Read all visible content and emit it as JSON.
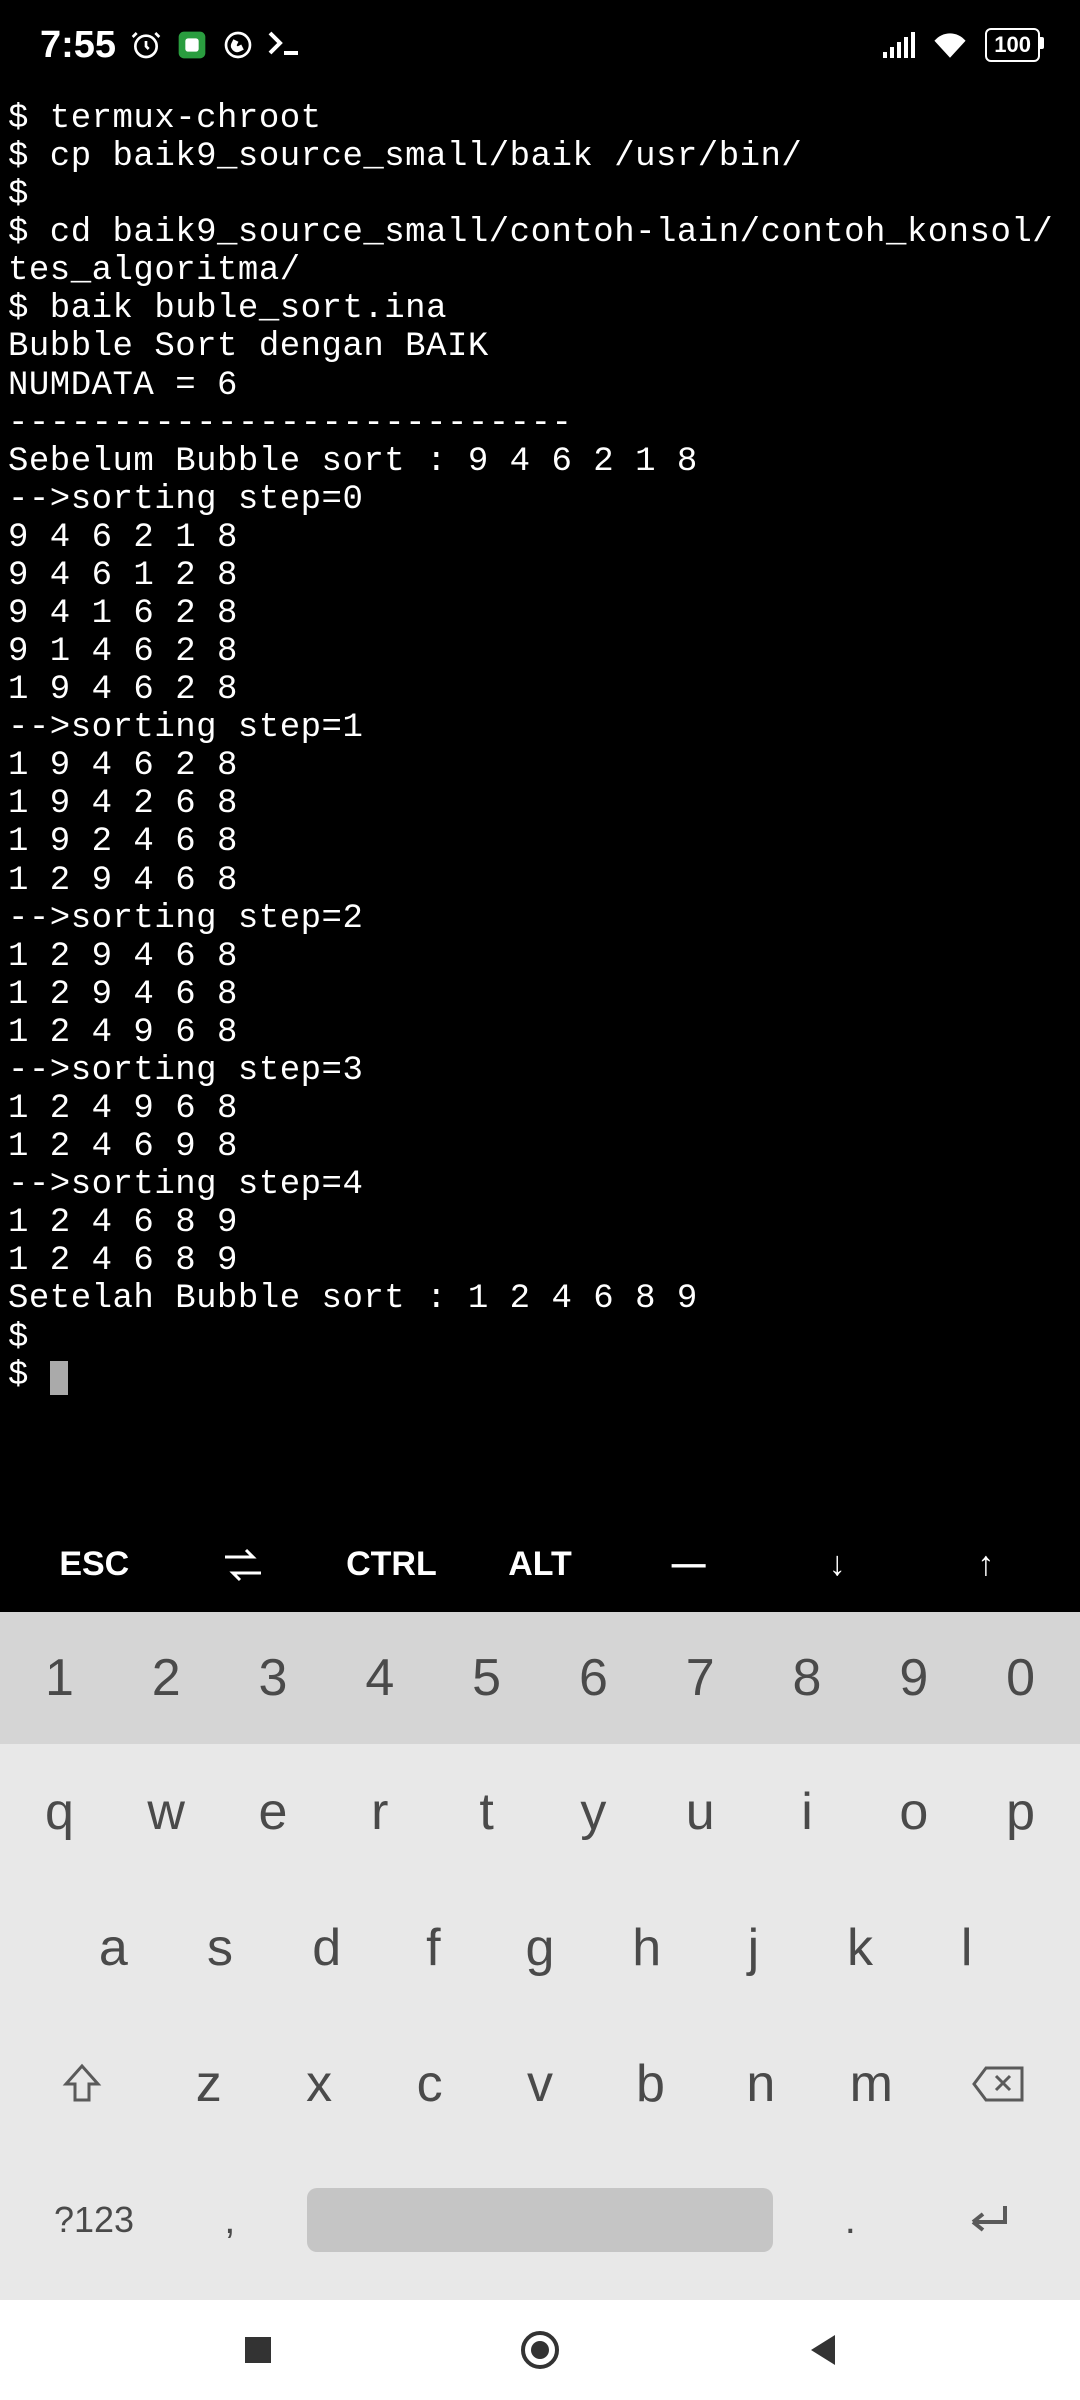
{
  "status": {
    "time": "7:55",
    "battery": "100"
  },
  "terminal_lines": [
    "$ termux-chroot",
    "$ cp baik9_source_small/baik /usr/bin/",
    "$",
    "$ cd baik9_source_small/contoh-lain/contoh_konsol/tes_algoritma/",
    "$ baik buble_sort.ina",
    "Bubble Sort dengan BAIK",
    "NUMDATA = 6",
    "---------------------------",
    "Sebelum Bubble sort : 9 4 6 2 1 8",
    "-->sorting step=0",
    "9 4 6 2 1 8",
    "9 4 6 1 2 8",
    "9 4 1 6 2 8",
    "9 1 4 6 2 8",
    "1 9 4 6 2 8",
    "-->sorting step=1",
    "1 9 4 6 2 8",
    "1 9 4 2 6 8",
    "1 9 2 4 6 8",
    "1 2 9 4 6 8",
    "-->sorting step=2",
    "1 2 9 4 6 8",
    "1 2 9 4 6 8",
    "1 2 4 9 6 8",
    "-->sorting step=3",
    "1 2 4 9 6 8",
    "1 2 4 6 9 8",
    "-->sorting step=4",
    "1 2 4 6 8 9",
    "1 2 4 6 8 9",
    "Setelah Bubble sort : 1 2 4 6 8 9",
    "$",
    "$ "
  ],
  "toolbar": {
    "esc": "ESC",
    "ctrl": "CTRL",
    "alt": "ALT",
    "minus": "—",
    "down": "↓",
    "up": "↑"
  },
  "keyboard": {
    "row_num": [
      "1",
      "2",
      "3",
      "4",
      "5",
      "6",
      "7",
      "8",
      "9",
      "0"
    ],
    "row_top": [
      "q",
      "w",
      "e",
      "r",
      "t",
      "y",
      "u",
      "i",
      "o",
      "p"
    ],
    "row_mid": [
      "a",
      "s",
      "d",
      "f",
      "g",
      "h",
      "j",
      "k",
      "l"
    ],
    "row_bot": [
      "z",
      "x",
      "c",
      "v",
      "b",
      "n",
      "m"
    ],
    "mode": "?123",
    "comma": ",",
    "period": "."
  }
}
